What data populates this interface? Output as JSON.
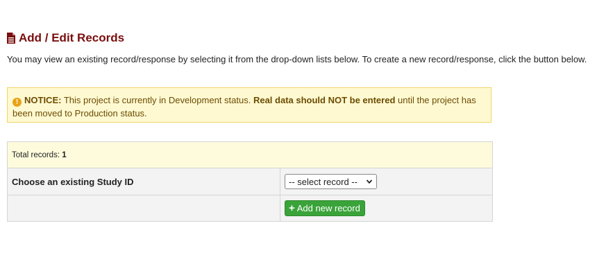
{
  "header": {
    "title": "Add / Edit Records",
    "icon": "document-icon"
  },
  "intro_text": "You may view an existing record/response by selecting it from the drop-down lists below. To create a new record/response, click the button below.",
  "notice": {
    "label": "NOTICE:",
    "text_before": " This project is currently in Development status. ",
    "bold_text": "Real data should NOT be entered",
    "text_after": " until the project has been moved to Production status.",
    "icon": "warning-icon"
  },
  "records": {
    "total_label": "Total records:",
    "total_count": "1",
    "choose_label": "Choose an existing Study ID",
    "select_value": "-- select record --",
    "add_button_label": "Add new record"
  },
  "colors": {
    "title": "#7a0e0e",
    "notice_bg": "#fff9d2",
    "notice_border": "#f0d568",
    "button_green": "#3aa33a"
  }
}
